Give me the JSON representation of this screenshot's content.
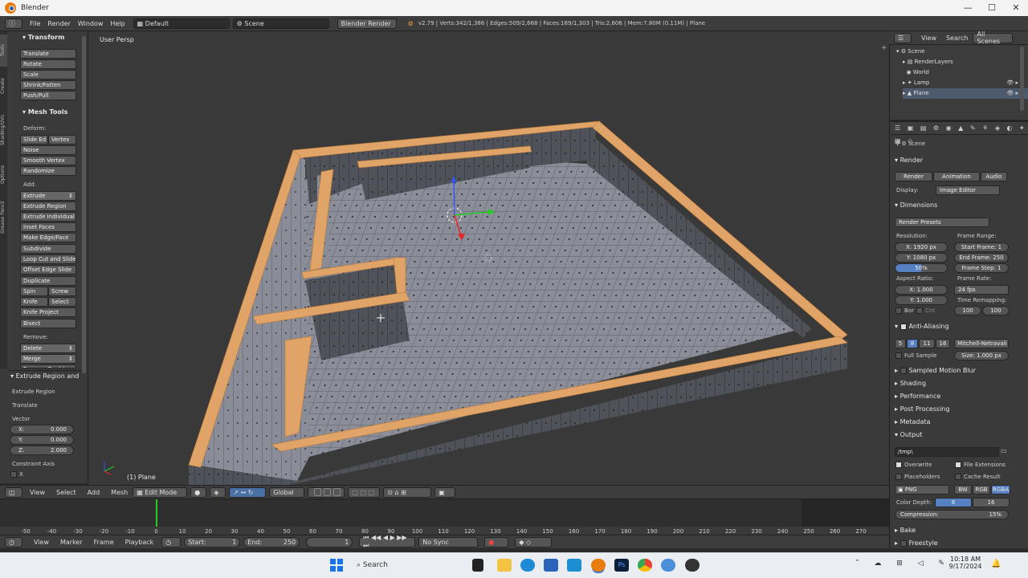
{
  "window": {
    "title": "Blender",
    "controls": [
      "—",
      "☐",
      "✕"
    ]
  },
  "info_header": {
    "menus": [
      "File",
      "Render",
      "Window",
      "Help"
    ],
    "screen_layout": "Default",
    "scene": "Scene",
    "engine": "Blender Render",
    "stats": "v2.79 | Verts:342/1,386 | Edges:509/2,668 | Faces:169/1,303 | Tris:2,606 | Mem:7.80M (0.11M) | Plane"
  },
  "toolshelf": {
    "tabs": [
      "Tools",
      "Create",
      "Shading/UVs",
      "Options",
      "Grease Pencil"
    ],
    "transform_header": "Transform",
    "transform_buttons": [
      "Translate",
      "Rotate",
      "Scale",
      "Shrink/Fatten",
      "Push/Pull"
    ],
    "mesh_tools_header": "Mesh Tools",
    "deform_label": "Deform:",
    "slide_edge": "Slide Ed",
    "vertex": "Vertex",
    "deform_buttons": [
      "Noise",
      "Smooth Vertex",
      "Randomize"
    ],
    "add_label": "Add:",
    "extrude": "Extrude",
    "add_buttons": [
      "Extrude Region",
      "Extrude Individual",
      "Inset Faces",
      "Make Edge/Face",
      "Subdivide",
      "Loop Cut and Slide",
      "Offset Edge Slide",
      "Duplicate"
    ],
    "spin": "Spin",
    "screw": "Screw",
    "knife": "Knife",
    "select": "Select",
    "knife_project": "Knife Project",
    "bisect": "Bisect",
    "remove_label": "Remove:",
    "delete": "Delete",
    "merge": "Merge",
    "remove_doubles": "Remove Doubles",
    "operator_header": "Extrude Region and",
    "operator_label": "Extrude Region",
    "translate_label": "Translate",
    "vector_label": "Vector",
    "vector": [
      {
        "axis": "X:",
        "value": "0.000"
      },
      {
        "axis": "Y:",
        "value": "0.000"
      },
      {
        "axis": "Z:",
        "value": "2.000"
      }
    ],
    "constraint_label": "Constraint Axis",
    "constraint_x": "X"
  },
  "viewport": {
    "view_label": "User Persp",
    "object_label": "(1) Plane"
  },
  "viewport_header": {
    "menus": [
      "View",
      "Select",
      "Add",
      "Mesh"
    ],
    "mode": "Edit Mode",
    "orientation": "Global"
  },
  "timeline": {
    "ruler": [
      "-50",
      "-40",
      "-30",
      "-20",
      "-10",
      "0",
      "10",
      "20",
      "30",
      "40",
      "50",
      "60",
      "70",
      "80",
      "90",
      "100",
      "110",
      "120",
      "130",
      "140",
      "150",
      "160",
      "170",
      "180",
      "190",
      "200",
      "210",
      "220",
      "230",
      "240",
      "250",
      "260",
      "270"
    ],
    "menus": [
      "View",
      "Marker",
      "Frame",
      "Playback"
    ],
    "start_label": "Start:",
    "start_value": "1",
    "end_label": "End:",
    "end_value": "250",
    "current_frame": "1",
    "sync": "No Sync"
  },
  "outliner": {
    "menus": [
      "View",
      "Search"
    ],
    "filter": "All Scenes",
    "rows": [
      "Scene",
      "RenderLayers",
      "World",
      "Lamp",
      "Plane"
    ]
  },
  "properties": {
    "breadcrumb": "Scene",
    "render_header": "Render",
    "render_buttons": [
      "Render",
      "Animation",
      "Audio"
    ],
    "display_label": "Display:",
    "display_value": "Image Editor",
    "dimensions_header": "Dimensions",
    "presets": "Render Presets",
    "resolution_label": "Resolution:",
    "res_x": "X:",
    "res_x_value": "1920 px",
    "res_y": "Y:",
    "res_y_value": "1080 px",
    "res_pct": "50%",
    "frame_range_label": "Frame Range:",
    "start_frame": "Start Frame: 1",
    "end_frame": "End Frame: 250",
    "frame_step": "Frame Step: 1",
    "aspect_label": "Aspect Ratio:",
    "asp_x": "X:",
    "asp_x_value": "1.000",
    "asp_y": "Y:",
    "asp_y_value": "1.000",
    "frame_rate_label": "Frame Rate:",
    "fps": "24 fps",
    "time_remap_label": "Time Remapping:",
    "remap_old": "100",
    "remap_new": "100",
    "border": "Bor",
    "crop": "Cro",
    "aa_header": "Anti-Aliasing",
    "aa_samples": [
      "5",
      "8",
      "11",
      "16"
    ],
    "aa_filter": "Mitchell-Netravali",
    "full_sample": "Full Sample",
    "aa_size": "Size: 1.000 px",
    "sampled_motion_blur": "Sampled Motion Blur",
    "shading": "Shading",
    "performance": "Performance",
    "post_processing": "Post Processing",
    "metadata": "Metadata",
    "output_header": "Output",
    "output_path": "/tmp\\",
    "overwrite": "Overwrite",
    "file_extensions": "File Extensions",
    "placeholders": "Placeholders",
    "cache_result": "Cache Result",
    "format": "PNG",
    "channels": [
      "BW",
      "RGB",
      "RGBA"
    ],
    "color_depth_label": "Color Depth:",
    "depths": [
      "8",
      "16"
    ],
    "compression": "Compression:",
    "compression_value": "15%",
    "bake": "Bake",
    "freestyle": "Freestyle"
  },
  "taskbar": {
    "search_placeholder": "Search",
    "time": "10:18 AM",
    "date": "9/17/2024"
  },
  "colors": {
    "accent": "#e87d0d",
    "selected_blue": "#5680c2",
    "wall_top": "#e0a468",
    "green_marker": "#22cc22"
  }
}
